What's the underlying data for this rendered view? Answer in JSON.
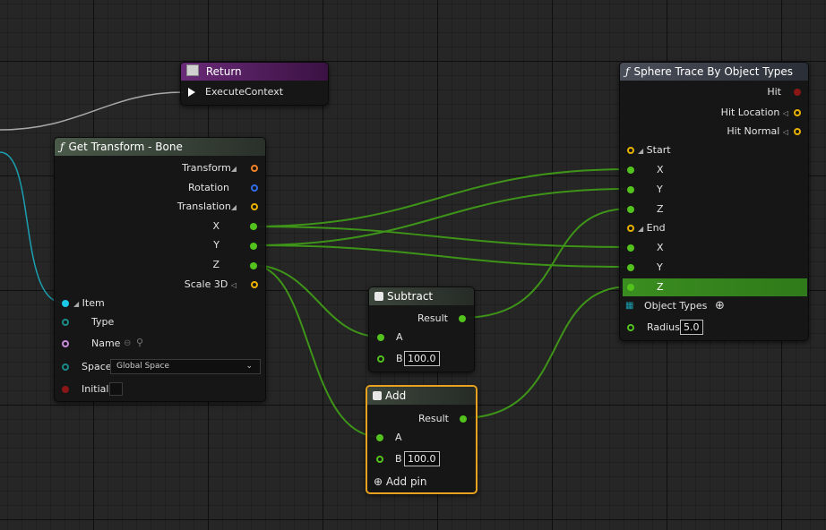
{
  "nodes": {
    "return": {
      "title": "Return",
      "pins": {
        "execute_context": "ExecuteContext"
      }
    },
    "get_transform": {
      "title": "Get Transform - Bone",
      "outputs": {
        "transform": "Transform",
        "rotation": "Rotation",
        "translation": "Translation",
        "x": "X",
        "y": "Y",
        "z": "Z",
        "scale3d": "Scale 3D"
      },
      "inputs": {
        "item": "Item",
        "type": "Type",
        "name": "Name",
        "space": "Space",
        "space_value": "Global Space",
        "initial": "Initial"
      }
    },
    "sphere_trace": {
      "title": "Sphere Trace By Object Types",
      "outputs": {
        "hit": "Hit",
        "hit_location": "Hit Location",
        "hit_normal": "Hit Normal"
      },
      "inputs": {
        "start": "Start",
        "start_x": "X",
        "start_y": "Y",
        "start_z": "Z",
        "end": "End",
        "end_x": "X",
        "end_y": "Y",
        "end_z": "Z",
        "object_types": "Object Types",
        "radius": "Radius",
        "radius_value": "5.0"
      }
    },
    "subtract": {
      "title": "Subtract",
      "result": "Result",
      "a": "A",
      "b": "B",
      "b_value": "100.0"
    },
    "add": {
      "title": "Add",
      "result": "Result",
      "a": "A",
      "b": "B",
      "b_value": "100.0",
      "add_pin": "Add pin"
    }
  },
  "colors": {
    "float_pin": "#53c21c",
    "vector_pin": "#e8b100",
    "transform_pin": "#f08025",
    "rotation_pin": "#2f6de8",
    "struct_pin": "#1aa0b0",
    "name_pin": "#c98ae0",
    "bool_pin": "#8a1616",
    "exec_pin": "#ffffff",
    "selected_border": "#e8a21f",
    "return_header": "#6a2a78",
    "function_header": "#3a4a3a",
    "math_header": "#2f3a2f"
  },
  "icons": [
    "function-icon",
    "return-node-icon",
    "math-node-icon",
    "plus-circle-icon",
    "search-icon",
    "dropdown-chevron-icon",
    "array-grid-icon"
  ]
}
